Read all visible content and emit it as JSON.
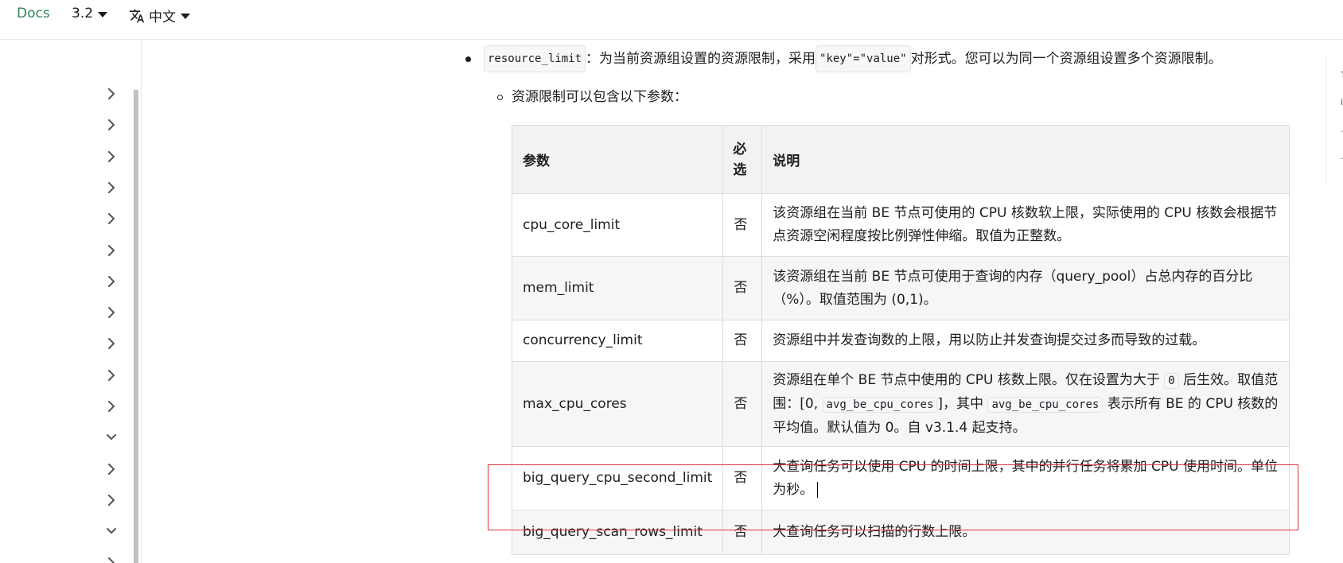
{
  "navbar": {
    "brand": "Docs",
    "version": "3.2",
    "language": "中文"
  },
  "sidebar": {
    "chevrons": [
      "right",
      "right",
      "right",
      "right",
      "right",
      "right",
      "right",
      "right",
      "right",
      "right",
      "right",
      "down",
      "right",
      "right",
      "down",
      "right"
    ]
  },
  "toc": {
    "items": [
      "T",
      "i",
      "…",
      "…"
    ]
  },
  "content": {
    "bullet_code": "resource_limit",
    "bullet_text_before": "：为当前资源组设置的资源限制，采用 ",
    "bullet_code2": "\"key\"=\"value\"",
    "bullet_text_after": " 对形式。您可以为同一个资源组设置多个资源限制。",
    "sub_bullet": "资源限制可以包含以下参数："
  },
  "table": {
    "headers": {
      "param": "参数",
      "required_line1": "必",
      "required_line2": "选",
      "desc": "说明"
    },
    "rows": [
      {
        "param": "cpu_core_limit",
        "required": "否",
        "desc": "该资源组在当前 BE 节点可使用的 CPU 核数软上限，实际使用的 CPU 核数会根据节点资源空闲程度按比例弹性伸缩。取值为正整数。"
      },
      {
        "param": "mem_limit",
        "required": "否",
        "desc": "该资源组在当前 BE 节点可使用于查询的内存（query_pool）占总内存的百分比（%）。取值范围为 (0,1)。"
      },
      {
        "param": "concurrency_limit",
        "required": "否",
        "desc": "资源组中并发查询数的上限，用以防止并发查询提交过多而导致的过载。"
      },
      {
        "param": "max_cpu_cores",
        "required": "否",
        "desc_a": "资源组在单个 BE 节点中使用的 CPU 核数上限。仅在设置为大于 ",
        "desc_code1": "0",
        "desc_b": " 后生效。取值范围：[0, ",
        "desc_code2": "avg_be_cpu_cores",
        "desc_c": "]，其中 ",
        "desc_code3": "avg_be_cpu_cores",
        "desc_d": " 表示所有 BE 的 CPU 核数的平均值。默认值为 0。自 v3.1.4 起支持。"
      },
      {
        "param": "big_query_cpu_second_limit",
        "required": "否",
        "desc": "大查询任务可以使用 CPU 的时间上限，其中的并行任务将累加 CPU 使用时间。单位为秒。"
      },
      {
        "param": "big_query_scan_rows_limit",
        "required": "否",
        "desc": "大查询任务可以扫描的行数上限。"
      }
    ]
  },
  "colors": {
    "brand": "#2e8555",
    "highlight": "#e0303a"
  }
}
